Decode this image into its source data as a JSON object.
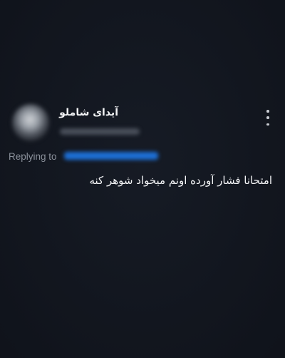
{
  "tweet": {
    "author_name": "آیدای شاملو",
    "replying_to_label": "Replying to",
    "text": "امتحانا فشار آورده اونم میخواد شوهر کنه"
  },
  "icons": {
    "more": "more-vertical-icon"
  },
  "colors": {
    "background": "#161b25",
    "text": "#f4f5f7",
    "secondary_text": "#8a909a",
    "link": "#1d6fd6"
  }
}
